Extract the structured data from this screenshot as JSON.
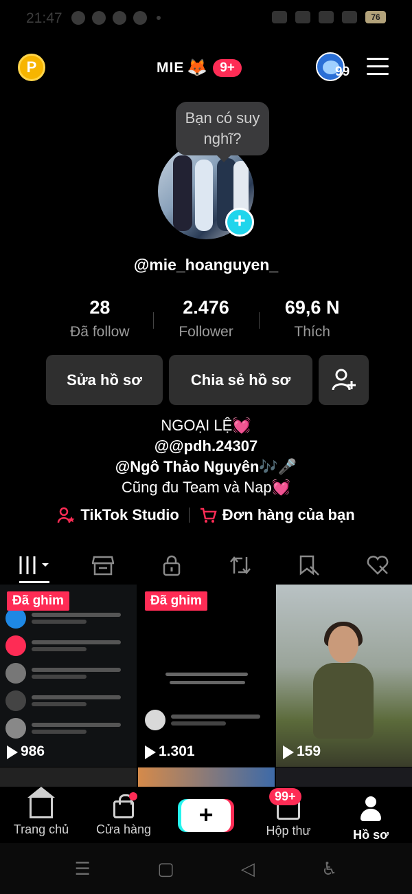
{
  "status_bar": {
    "time": "21:47",
    "battery": "76"
  },
  "top_bar": {
    "coin_label": "P",
    "brand_name": "MIE",
    "brand_emoji": "🦊",
    "brand_badge": "9+",
    "mini_avatar_count": "99"
  },
  "profile": {
    "tooltip": "Bạn có suy nghĩ?",
    "add_icon": "+",
    "username": "@mie_hoanguyen_",
    "stats": [
      {
        "value": "28",
        "label": "Đã follow"
      },
      {
        "value": "2.476",
        "label": "Follower"
      },
      {
        "value": "69,6 N",
        "label": "Thích"
      }
    ],
    "buttons": {
      "edit": "Sửa hồ sơ",
      "share": "Chia sẻ hồ sơ"
    },
    "bio": [
      "NGOẠI LỆ💓",
      "@@pdh.24307",
      "@Ngô Thảo Nguyên🎶🎤",
      "Cũng đu Team và Nap💓"
    ],
    "links": {
      "studio": "TikTok Studio",
      "orders": "Đơn hàng của bạn"
    }
  },
  "tabs": [
    "grid-icon",
    "shop-icon",
    "lock-icon",
    "repost-icon",
    "bookmark-icon",
    "heart-icon"
  ],
  "videos": [
    {
      "pinned": "Đã ghim",
      "views": "986"
    },
    {
      "pinned": "Đã ghim",
      "views": "1.301"
    },
    {
      "pinned": "",
      "views": "159"
    }
  ],
  "bottom_nav": {
    "home": "Trang chủ",
    "shop": "Cửa hàng",
    "create_icon": "+",
    "inbox": "Hộp thư",
    "inbox_badge": "99+",
    "profile": "Hồ sơ"
  },
  "colors": {
    "accent": "#fe2c55",
    "cyan": "#20d5ec",
    "button_bg": "#2f2f2f"
  }
}
